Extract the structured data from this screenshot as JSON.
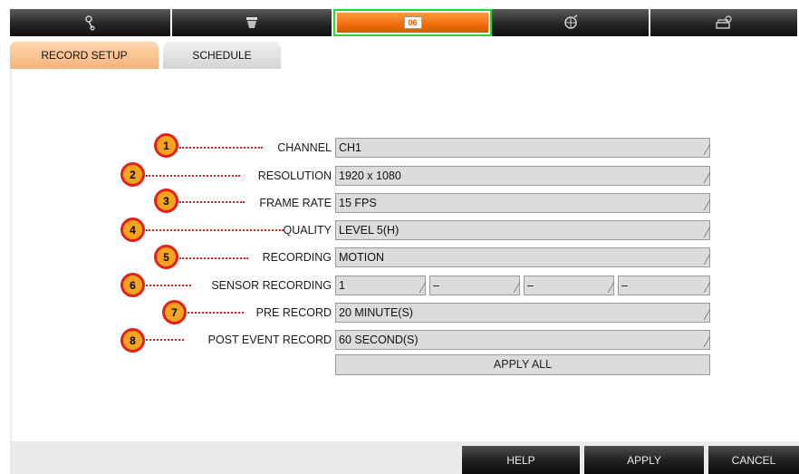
{
  "toolbar": {
    "items": [
      {
        "icon": "tools-icon"
      },
      {
        "icon": "camera-dome-icon"
      },
      {
        "icon": "calendar-icon",
        "badge": "06",
        "active": true
      },
      {
        "icon": "network-icon"
      },
      {
        "icon": "system-icon"
      }
    ]
  },
  "tabs": {
    "record_setup": "RECORD SETUP",
    "schedule": "SCHEDULE"
  },
  "form": {
    "channel": {
      "label": "CHANNEL",
      "value": "CH1",
      "marker": "1"
    },
    "resolution": {
      "label": "RESOLUTION",
      "value": "1920 x 1080",
      "marker": "2"
    },
    "frame_rate": {
      "label": "FRAME RATE",
      "value": "15 FPS",
      "marker": "3"
    },
    "quality": {
      "label": "QUALITY",
      "value": "LEVEL 5(H)",
      "marker": "4"
    },
    "recording": {
      "label": "RECORDING",
      "value": "MOTION",
      "marker": "5"
    },
    "sensor_recording": {
      "label": "SENSOR RECORDING",
      "values": [
        "1",
        "–",
        "–",
        "–"
      ],
      "marker": "6"
    },
    "pre_record": {
      "label": "PRE RECORD",
      "value": "20 MINUTE(S)",
      "marker": "7"
    },
    "post_event_record": {
      "label": "POST EVENT RECORD",
      "value": "60 SECOND(S)",
      "marker": "8"
    },
    "apply_all": "APPLY ALL"
  },
  "footer": {
    "help": "HELP",
    "apply": "APPLY",
    "cancel": "CANCEL"
  },
  "colors": {
    "accent_orange": "#f06d0c",
    "active_outline": "#2fd42f",
    "marker_fill": "#f6a31d",
    "marker_border": "#e3211b"
  }
}
